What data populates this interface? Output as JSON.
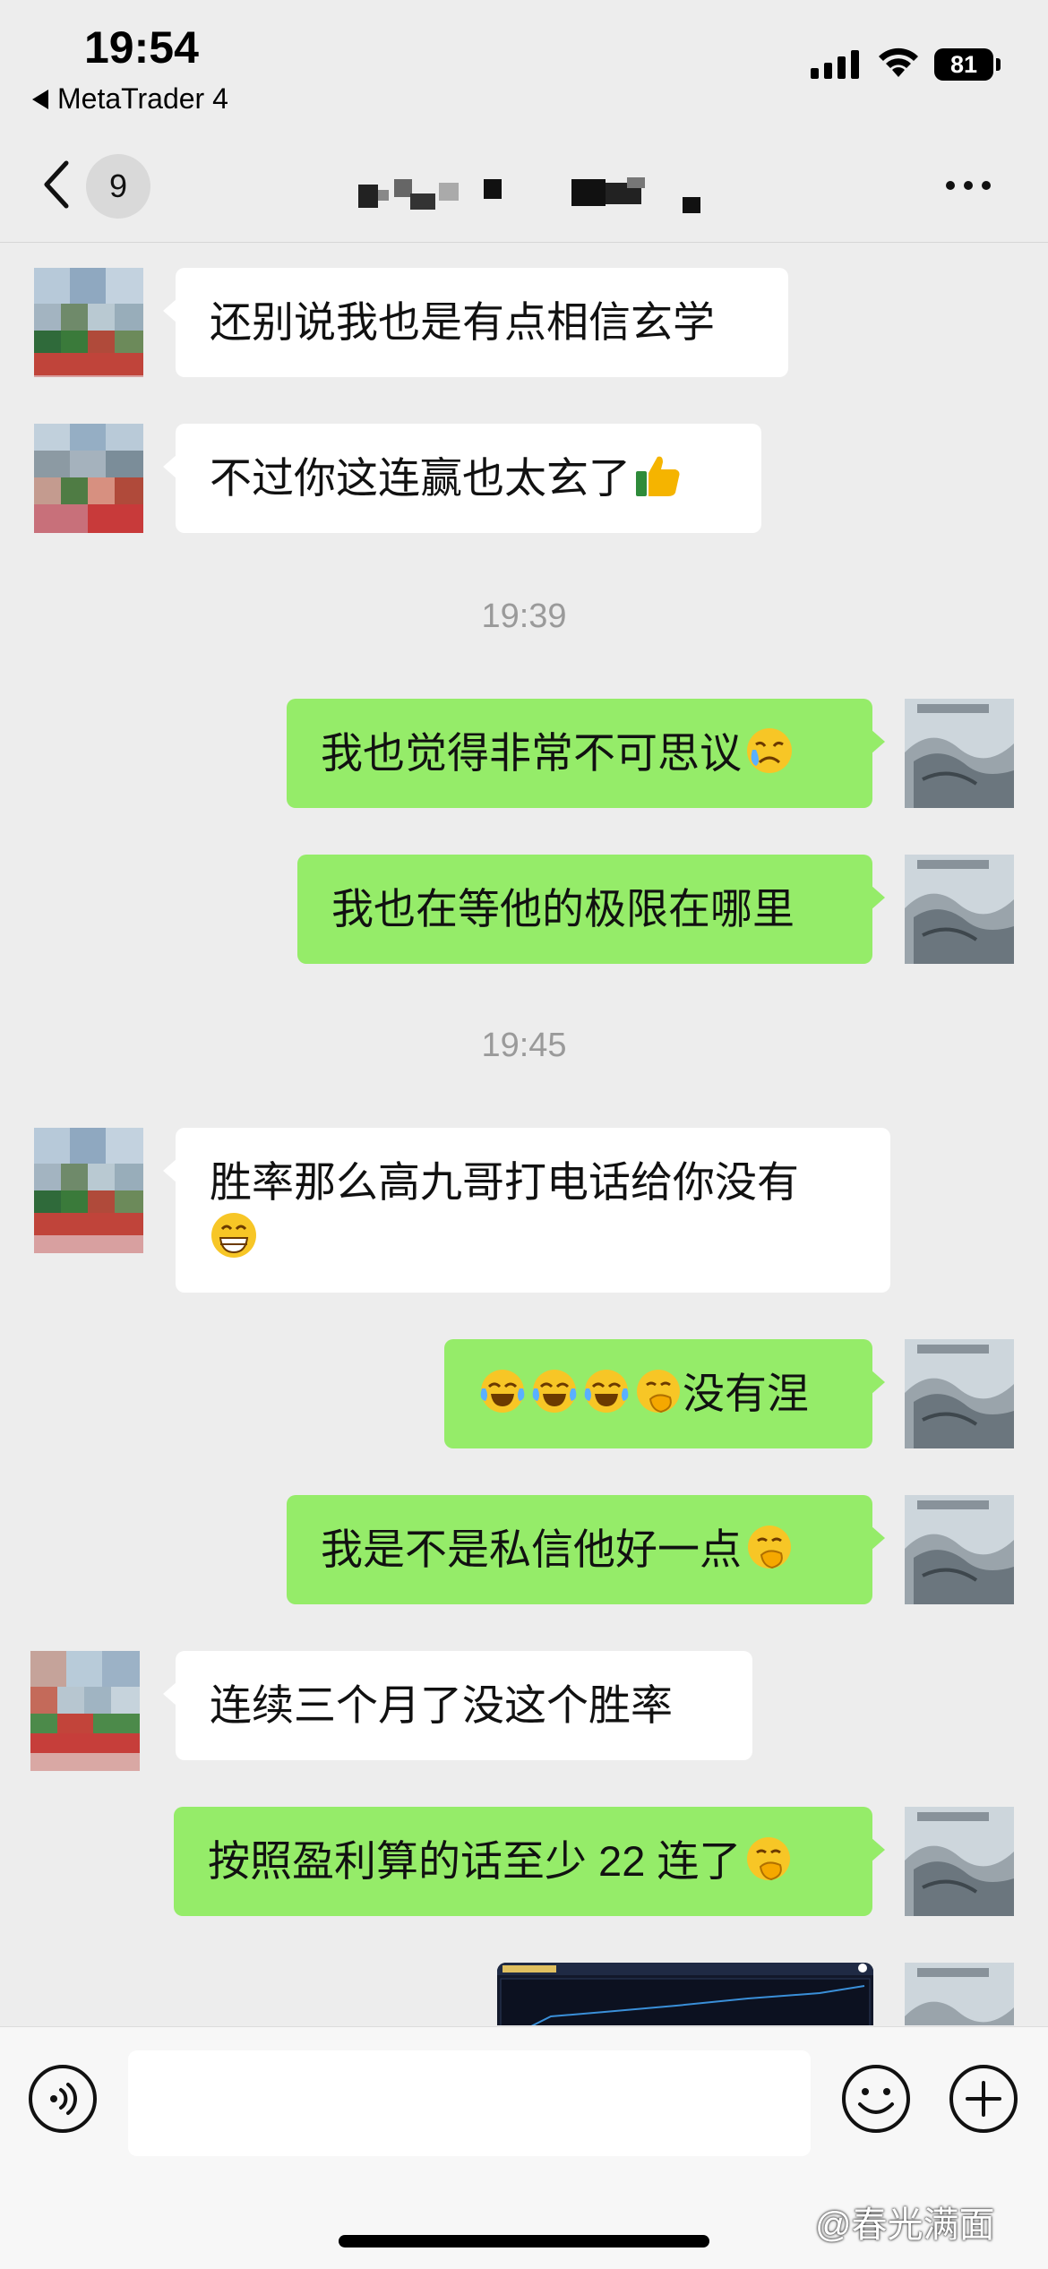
{
  "status_bar": {
    "time": "19:54",
    "back_app": "MetaTrader 4",
    "battery": "81"
  },
  "nav": {
    "unread_badge": "9"
  },
  "messages": [
    {
      "id": "m1",
      "side": "peer",
      "text": "还别说我也是有点相信玄学"
    },
    {
      "id": "m2",
      "side": "peer",
      "text": "不过你这连赢也太玄了",
      "emoji": "thumbs-up"
    },
    {
      "id": "t1",
      "type": "timestamp",
      "text": "19:39"
    },
    {
      "id": "m3",
      "side": "self",
      "text": "我也觉得非常不可思议",
      "emoji": "crying-face"
    },
    {
      "id": "m4",
      "side": "self",
      "text": "我也在等他的极限在哪里"
    },
    {
      "id": "t2",
      "type": "timestamp",
      "text": "19:45"
    },
    {
      "id": "m5",
      "side": "peer",
      "text": "胜率那么高九哥打电话给你没有",
      "emoji": "grin-face"
    },
    {
      "id": "m6",
      "side": "self",
      "text": "没有涅",
      "emoji_prefix": [
        "tears-of-joy",
        "tears-of-joy",
        "tears-of-joy",
        "hand-over-mouth"
      ]
    },
    {
      "id": "m7",
      "side": "self",
      "text": "我是不是私信他好一点",
      "emoji": "hand-over-mouth"
    },
    {
      "id": "m8",
      "side": "peer",
      "text": "连续三个月了没这个胜率"
    },
    {
      "id": "m9",
      "side": "self",
      "text": "按照盈利算的话至少 22 连了",
      "emoji": "hand-over-mouth"
    },
    {
      "id": "m10",
      "side": "self",
      "type": "image",
      "content": "trading-chart-screenshot"
    }
  ],
  "input_bar": {
    "placeholder": ""
  },
  "watermark": "@春光满面",
  "colors": {
    "self_bubble": "#95ec69",
    "peer_bubble": "#ffffff",
    "background": "#ededed"
  }
}
